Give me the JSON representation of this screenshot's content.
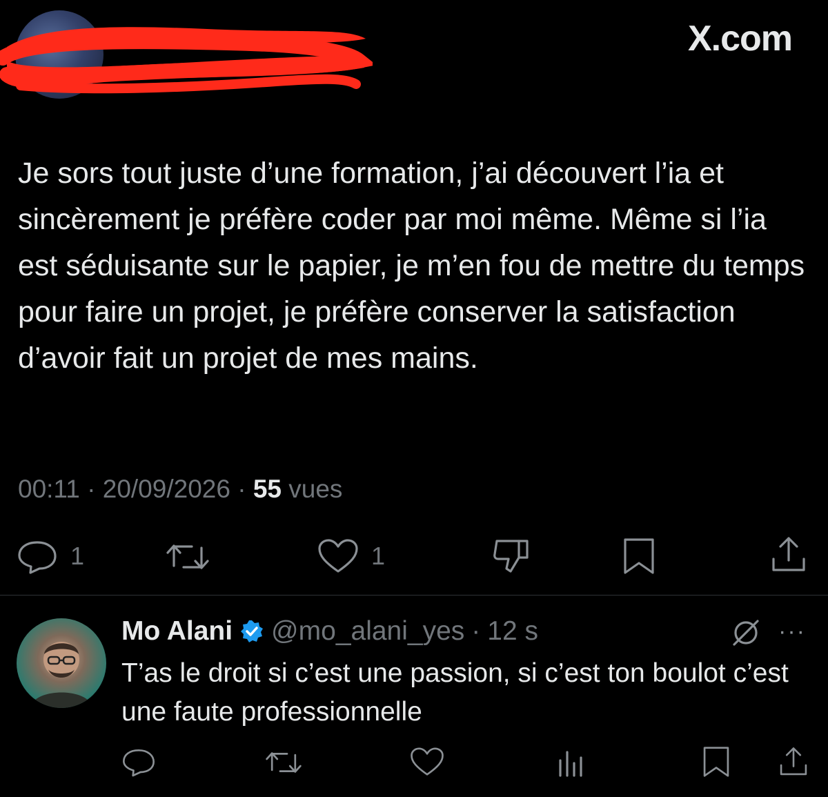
{
  "brand": "X.com",
  "tweet": {
    "text": "Je sors tout juste d’une formation, j’ai découvert l’ia et sincèrement je préfère coder par moi même. Même si l’ia est séduisante sur le papier, je m’en fou de mettre du temps pour faire un projet, je préfère conserver la satisfaction d’avoir fait un projet de mes mains.",
    "time": "00:11",
    "date": "20/09/2026",
    "views_count": "55",
    "views_label": "vues",
    "separator": "·",
    "reply_count": "1",
    "like_count": "1"
  },
  "reply": {
    "name": "Mo Alani",
    "handle": "@mo_alani_yes",
    "separator": "·",
    "time": "12 s",
    "text": "T’as le droit si c’est une passion, si c’est ton boulot c’est une faute professionnelle",
    "more": "···"
  },
  "colors": {
    "background": "#000000",
    "text": "#e7e9ea",
    "muted": "#71767b",
    "verified": "#1d9bf0",
    "redaction": "#ff2a1a"
  },
  "icons": [
    "reply-icon",
    "retweet-icon",
    "like-icon",
    "dislike-icon",
    "bookmark-icon",
    "share-icon",
    "verified-badge-icon",
    "grok-icon",
    "more-icon",
    "views-icon"
  ]
}
